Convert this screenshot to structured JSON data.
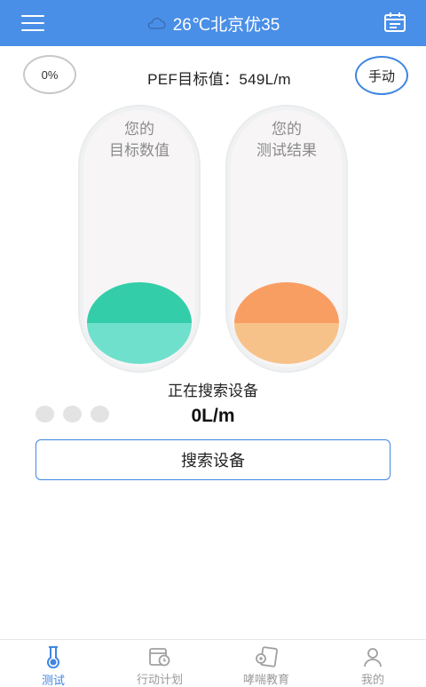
{
  "header": {
    "weather_text": "26℃北京优35",
    "weather_icon": "cloud-icon",
    "menu_icon": "hamburger-menu-icon",
    "calendar_icon": "calendar-icon",
    "bar_color": "#4a8fe7"
  },
  "progress": {
    "label": "0%",
    "value": 0
  },
  "target": {
    "text": "PEF目标值：549L/m",
    "value": 549,
    "unit": "L/m"
  },
  "manual_button": {
    "label": "手动"
  },
  "tubes": {
    "target": {
      "line1": "您的",
      "line2": "目标数值",
      "colors": [
        "#33cda9",
        "#6fe0cb"
      ]
    },
    "result": {
      "line1": "您的",
      "line2": "测试结果",
      "colors": [
        "#f99e63",
        "#f7c289"
      ]
    }
  },
  "status_text": "正在搜索设备",
  "reading": "0L/m",
  "search_button": {
    "label": "搜索设备"
  },
  "tabs": [
    {
      "label": "测试",
      "icon": "test-tube-icon",
      "active": true
    },
    {
      "label": "行动计划",
      "icon": "action-plan-icon",
      "active": false
    },
    {
      "label": "哮喘教育",
      "icon": "education-icon",
      "active": false
    },
    {
      "label": "我的",
      "icon": "profile-icon",
      "active": false
    }
  ]
}
